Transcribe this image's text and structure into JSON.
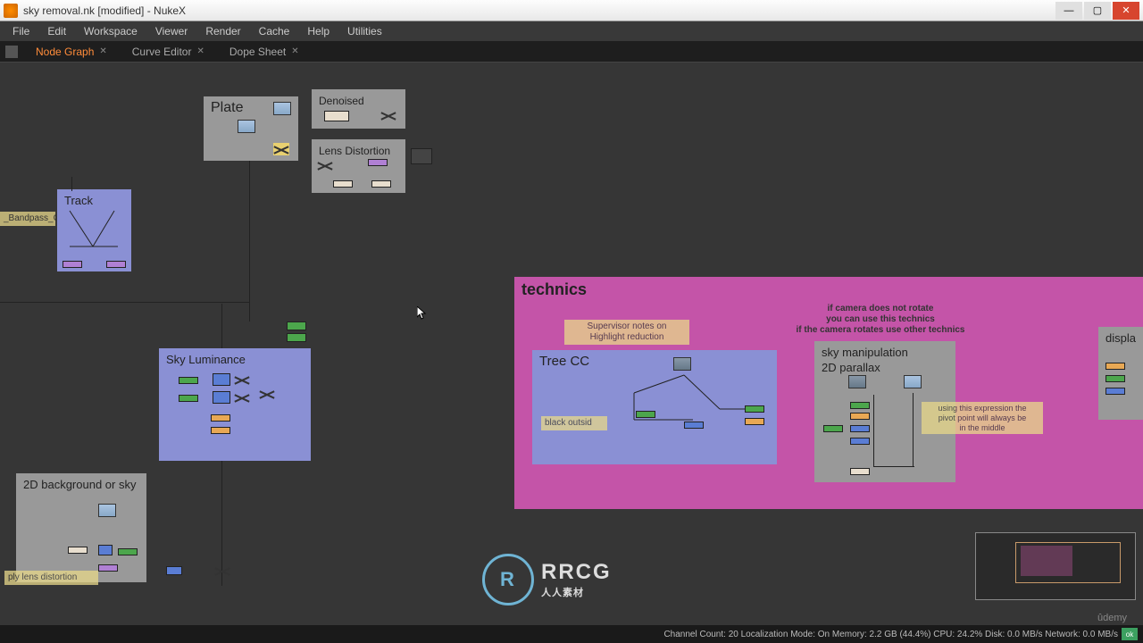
{
  "window": {
    "title": "sky removal.nk [modified] - NukeX"
  },
  "menubar": [
    "File",
    "Edit",
    "Workspace",
    "Viewer",
    "Render",
    "Cache",
    "Help",
    "Utilities"
  ],
  "tabs": [
    {
      "label": "Node Graph",
      "active": true
    },
    {
      "label": "Curve Editor",
      "active": false
    },
    {
      "label": "Dope Sheet",
      "active": false
    }
  ],
  "backdrops": {
    "plate": "Plate",
    "denoised": "Denoised",
    "lens_distortion": "Lens Distortion",
    "track": "Track",
    "bandpass": "_Bandpass_Grade",
    "sky_lum": "Sky Luminance",
    "bg2d": "2D background or sky",
    "apply_lens": "ply lens distortion",
    "technics": "technics",
    "treecc": "Tree CC",
    "skyman": "sky manipulation\n2D parallax",
    "displa": "displa"
  },
  "stickies": {
    "supervisor": "Supervisor notes on\nHighlight reduction",
    "camera": "if camera does not rotate\nyou can use this technics\nif the camera rotates use other technics",
    "expression": "using this expression the\npivot point will always be\nin the middle",
    "black_outside": "black outsid"
  },
  "statusbar": {
    "text": "Channel Count: 20 Localization Mode: On Memory: 2.2 GB (44.4%) CPU: 24.2% Disk: 0.0 MB/s Network: 0.0 MB/s",
    "ok": "ok"
  },
  "watermark": {
    "logo": "R",
    "main": "RRCG",
    "sub": "人人素材"
  },
  "udemy": "ûdemy"
}
